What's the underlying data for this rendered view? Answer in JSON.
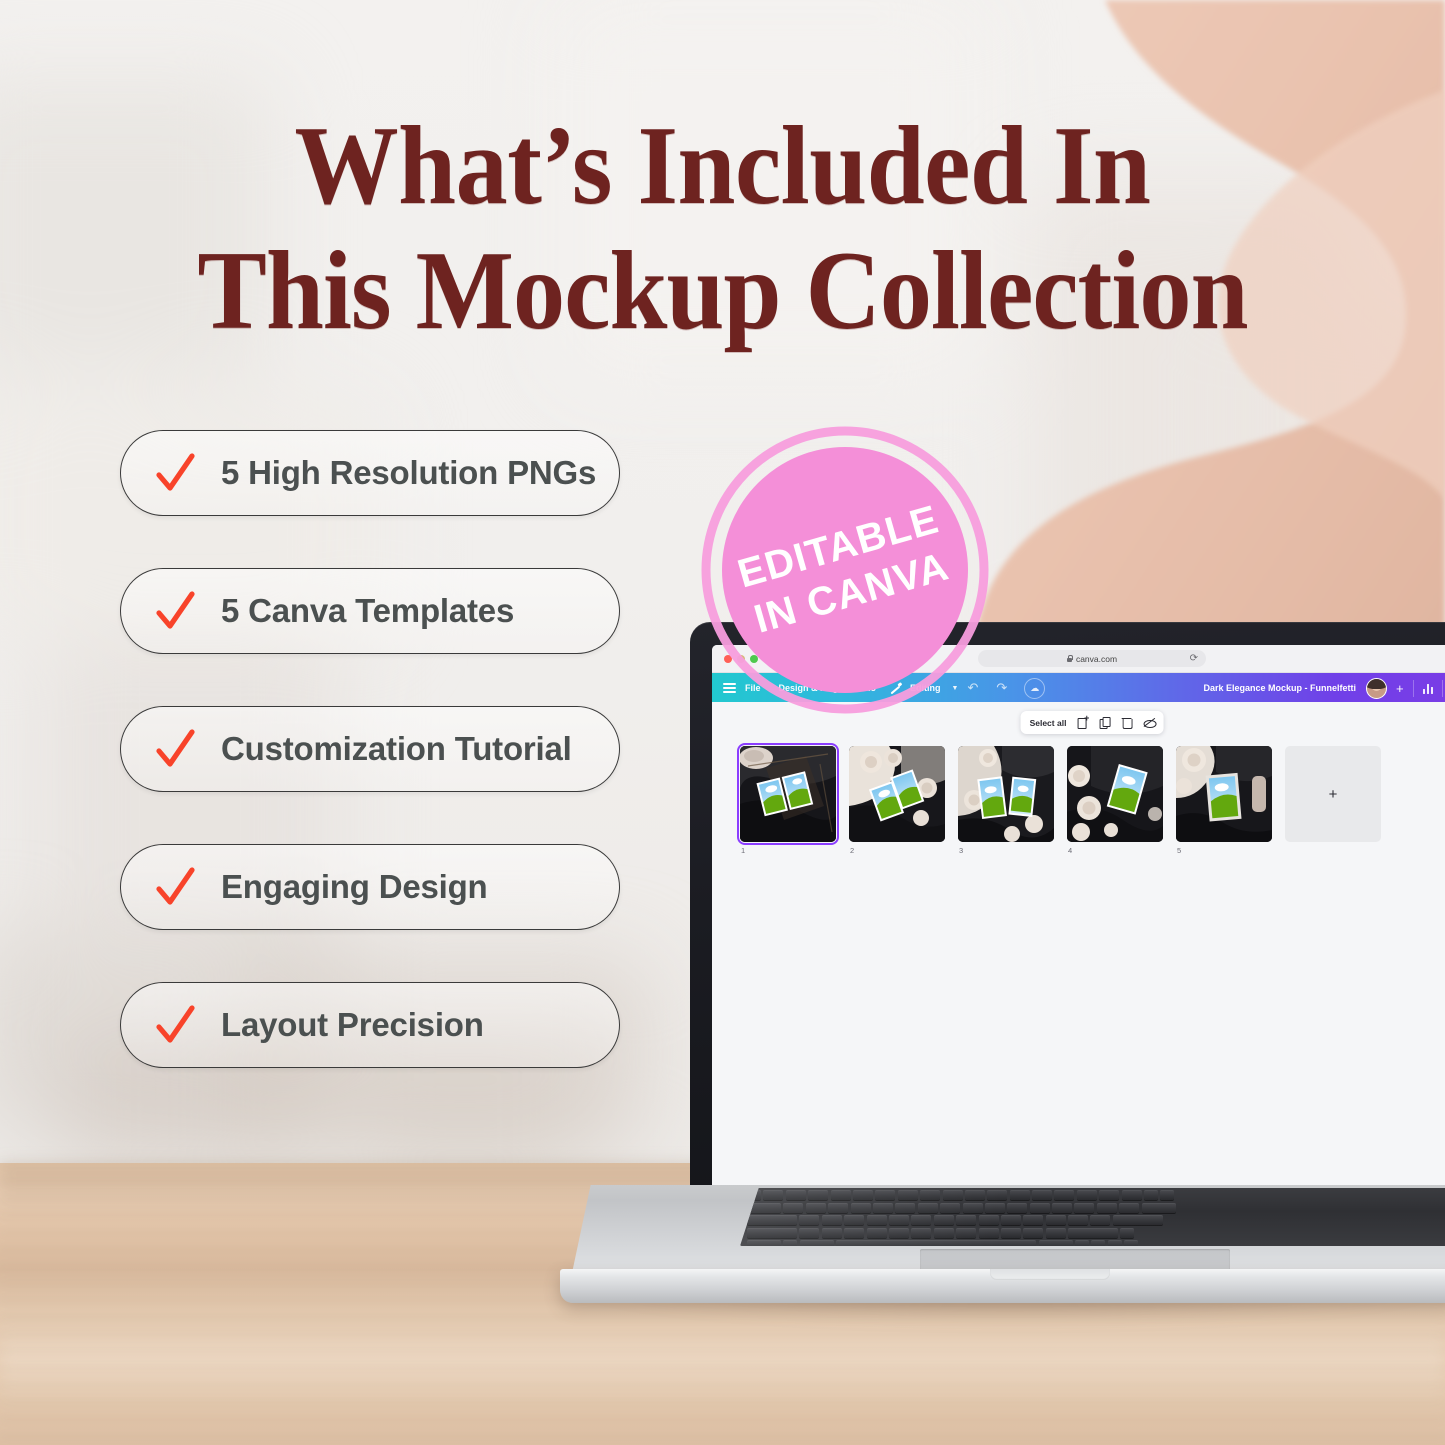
{
  "headline": {
    "line1": "What’s Included In",
    "line2": "This Mockup Collection",
    "color": "#6e2320"
  },
  "features": [
    {
      "label": "5 High Resolution PNGs",
      "check": "check-icon"
    },
    {
      "label": "5 Canva Templates",
      "check": "check-icon"
    },
    {
      "label": "Customization Tutorial",
      "check": "check-icon"
    },
    {
      "label": "Engaging Design",
      "check": "check-icon"
    },
    {
      "label": "Layout Precision",
      "check": "check-icon"
    }
  ],
  "badge": {
    "line1": "EDITABLE",
    "line2": "IN CANVA",
    "fill": "#f48fd8",
    "ring": "#f79ddd"
  },
  "laptop": {
    "browser": {
      "url": "canva.com",
      "lock": "lock-icon",
      "reload": "⟳",
      "traffic_lights": [
        "close",
        "minimize",
        "zoom"
      ],
      "tab_icon": "tabs-icon"
    },
    "canva": {
      "menu_icon": "hamburger-icon",
      "menu_items": [
        "File",
        "Design & Magic Studio"
      ],
      "edit_mode": "Editing",
      "edit_icon": "pen-icon",
      "undo_icon": "undo-arrow-icon",
      "redo_icon": "redo-arrow-icon",
      "cloud_icon": "cloud-save-icon",
      "doc_title": "Dark Elegance Mockup - Funnelfetti",
      "avatar": "user-avatar",
      "plus_icon": "plus-icon",
      "insights_icon": "bar-chart-icon",
      "search_icon": "search-icon",
      "toolbar": {
        "select_all": "Select all",
        "icons": [
          "add-page-icon",
          "duplicate-page-icon",
          "delete-page-icon",
          "hide-page-icon"
        ]
      },
      "pages": [
        {
          "number": "1",
          "selected": true,
          "variant": "a"
        },
        {
          "number": "2",
          "selected": false,
          "variant": "b"
        },
        {
          "number": "3",
          "selected": false,
          "variant": "c"
        },
        {
          "number": "4",
          "selected": false,
          "variant": "d"
        },
        {
          "number": "5",
          "selected": false,
          "variant": "e"
        }
      ],
      "add_page": {
        "label": "+"
      }
    }
  },
  "colors": {
    "title": "#6e2320",
    "check": "#f8432a",
    "pill_text": "#4b5050",
    "pill_border": "#3a3a3a",
    "badge_pink": "#f48fd8",
    "canva_selection": "#8b3dff",
    "desk": "#e0c2a6",
    "blob_peach": "#edc8b5"
  }
}
